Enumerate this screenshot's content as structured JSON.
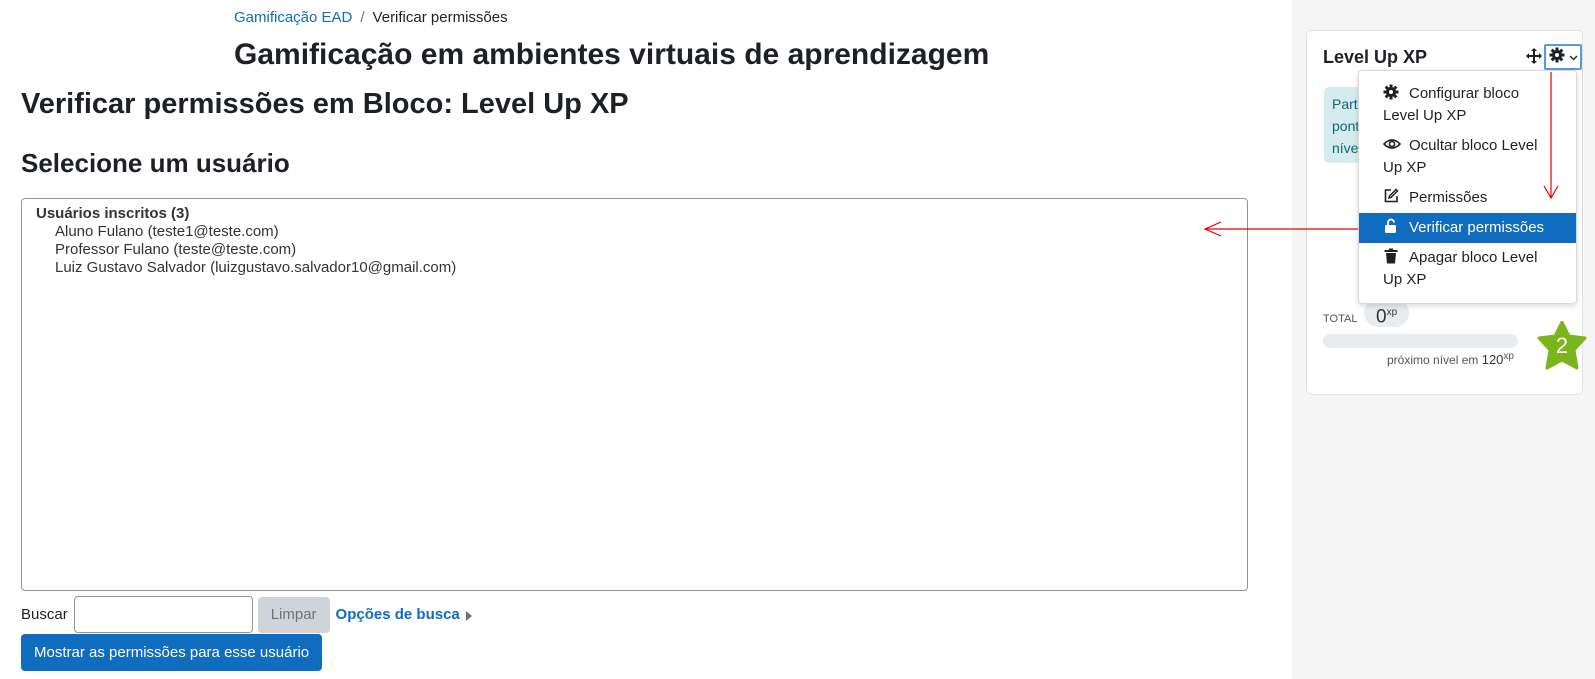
{
  "breadcrumb": {
    "items": [
      "Gamificação EAD",
      "Verificar permissões"
    ],
    "separator": "/"
  },
  "course_title": "Gamificação em ambientes virtuais de aprendizagem",
  "page_heading": "Verificar permissões em Bloco: Level Up XP",
  "section_heading": "Selecione um usuário",
  "user_select": {
    "group_label": "Usuários inscritos (3)",
    "options": [
      "Aluno Fulano (teste1@teste.com)",
      "Professor Fulano (teste@teste.com)",
      "Luiz Gustavo Salvador (luizgustavo.salvador10@gmail.com)"
    ]
  },
  "search": {
    "label": "Buscar",
    "value": "",
    "clear_label": "Limpar",
    "options_label": "Opções de busca"
  },
  "submit_label": "Mostrar as permissões para esse usuário",
  "block": {
    "title": "Level Up XP",
    "info_lines": [
      "Part",
      "pont",
      "níve"
    ],
    "total_label": "TOTAL",
    "xp_value": "0",
    "xp_unit": "xp",
    "progress_fraction": 0,
    "next_level_label": "próximo nível em",
    "next_level_value": "120",
    "level": "2",
    "colors": {
      "star": "#7ab51d",
      "accent": "#0f6cbf",
      "info_bg": "#d5ecef"
    }
  },
  "menu": {
    "items": [
      {
        "label": "Configurar bloco Level Up XP",
        "icon": "gear-icon",
        "active": false
      },
      {
        "label": "Ocultar bloco Level Up XP",
        "icon": "eye-icon",
        "active": false
      },
      {
        "label": "Permissões",
        "icon": "edit-icon",
        "active": false
      },
      {
        "label": "Verificar permissões",
        "icon": "unlock-icon",
        "active": true
      },
      {
        "label": "Apagar bloco Level Up XP",
        "icon": "trash-icon",
        "active": false
      }
    ]
  }
}
